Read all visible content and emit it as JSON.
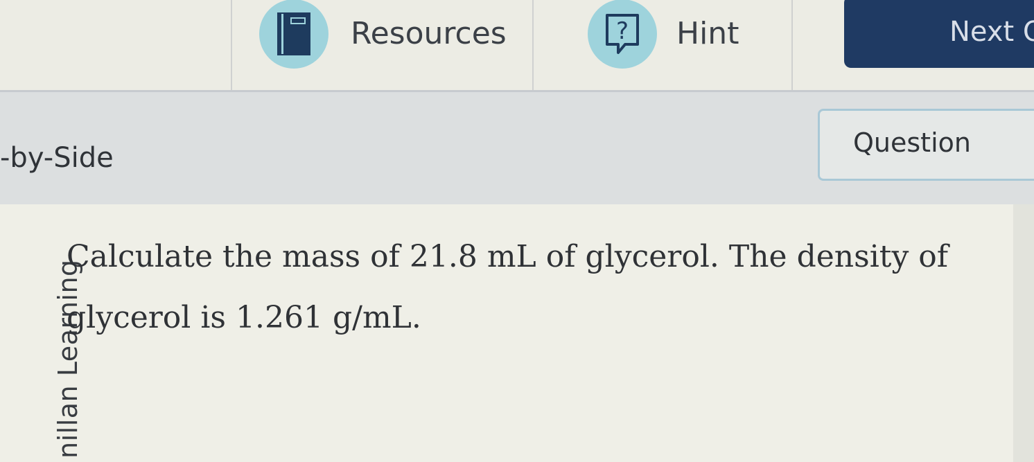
{
  "toolbar": {
    "resources_label": "Resources",
    "hint_label": "Hint",
    "next_label": "Next Q",
    "icons": {
      "resources": "book-icon",
      "hint": "question-mark-icon"
    },
    "colors": {
      "icon_circle": "#9ed3dc",
      "next_button": "#1f3a63"
    }
  },
  "view_modes": {
    "side_by_side_label": "-by-Side",
    "question_label": "Question"
  },
  "watermark": "nillan Learning",
  "question": {
    "text_line1": "Calculate the mass of 21.8 mL of glycerol. The density of",
    "text_line2": "glycerol is 1.261 g/mL."
  }
}
